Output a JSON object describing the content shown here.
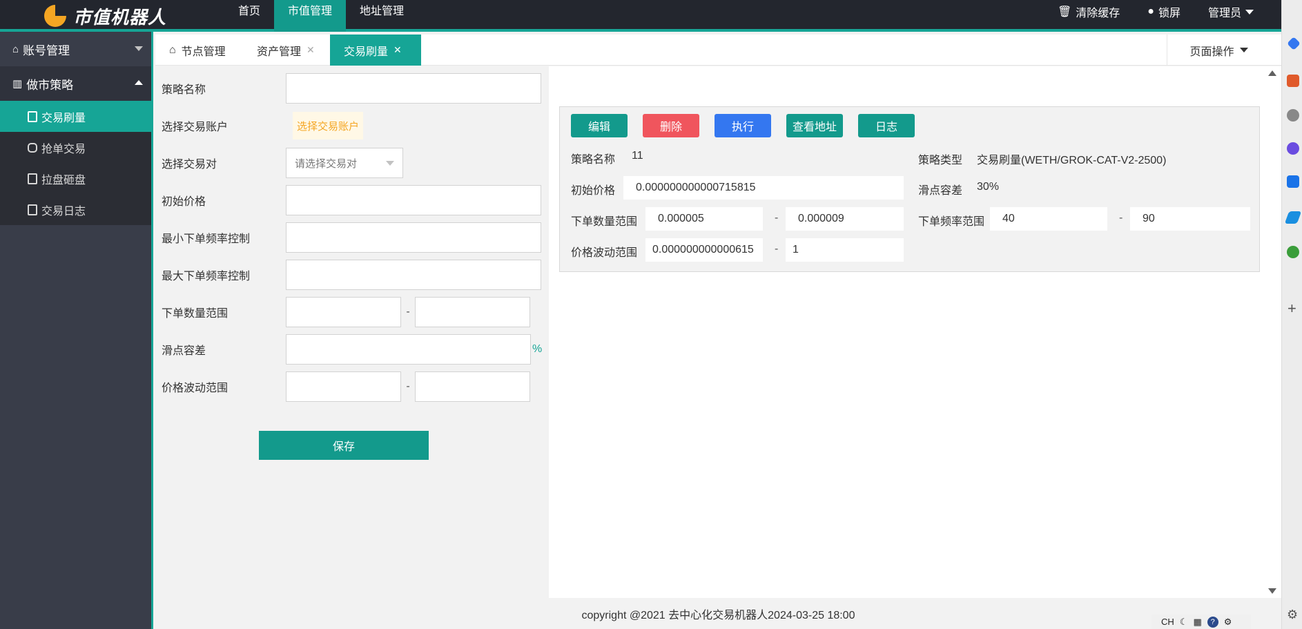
{
  "header": {
    "logo_text": "市值机器人",
    "nav": [
      "首页",
      "市值管理",
      "地址管理"
    ],
    "right": {
      "clear_cache": "清除缓存",
      "lock_screen": "锁屏",
      "admin": "管理员"
    }
  },
  "sidebar": {
    "groups": [
      {
        "label": "账号管理"
      },
      {
        "label": "做市策略"
      }
    ],
    "sub_items": [
      "交易刷量",
      "抢单交易",
      "拉盘砸盘",
      "交易日志"
    ]
  },
  "tabs": {
    "items": [
      "节点管理",
      "资产管理",
      "交易刷量"
    ],
    "close_glyph": "✕",
    "page_ops": "页面操作"
  },
  "form": {
    "strategy_name_label": "策略名称",
    "select_account_label": "选择交易账户",
    "select_account_button": "选择交易账户",
    "select_pair_label": "选择交易对",
    "select_pair_placeholder": "请选择交易对",
    "initial_price_label": "初始价格",
    "min_freq_label": "最小下单频率控制",
    "max_freq_label": "最大下单频率控制",
    "order_qty_range_label": "下单数量范围",
    "slippage_label": "滑点容差",
    "slippage_unit": "%",
    "price_range_label": "价格波动范围",
    "range_dash": "-",
    "save_button": "保存"
  },
  "card": {
    "buttons": {
      "edit": "编辑",
      "delete": "删除",
      "execute": "执行",
      "view_address": "查看地址",
      "log": "日志"
    },
    "strategy_name_label": "策略名称",
    "strategy_name_value": "11",
    "strategy_type_label": "策略类型",
    "strategy_type_value": "交易刷量(WETH/GROK-CAT-V2-2500)",
    "initial_price_label": "初始价格",
    "initial_price_value": "0.000000000000715815",
    "slippage_label": "滑点容差",
    "slippage_value": "30%",
    "order_qty_label": "下单数量范围",
    "order_qty_min": "0.000005",
    "order_qty_max": "0.000009",
    "freq_label": "下单频率范围",
    "freq_min": "40",
    "freq_max": "90",
    "price_range_label": "价格波动范围",
    "price_range_min": "0.000000000000615",
    "price_range_max": "1",
    "dash": "-"
  },
  "footer": {
    "text": "copyright @2021 去中心化交易机器人2024-03-25 18:00"
  },
  "tray": {
    "ime": "CH"
  },
  "colors": {
    "accent": "#16a596",
    "header_bg": "#23262e",
    "sidebar_bg": "#393d49",
    "danger": "#f0555d",
    "primary": "#3477f0",
    "warn": "#f5a623"
  }
}
